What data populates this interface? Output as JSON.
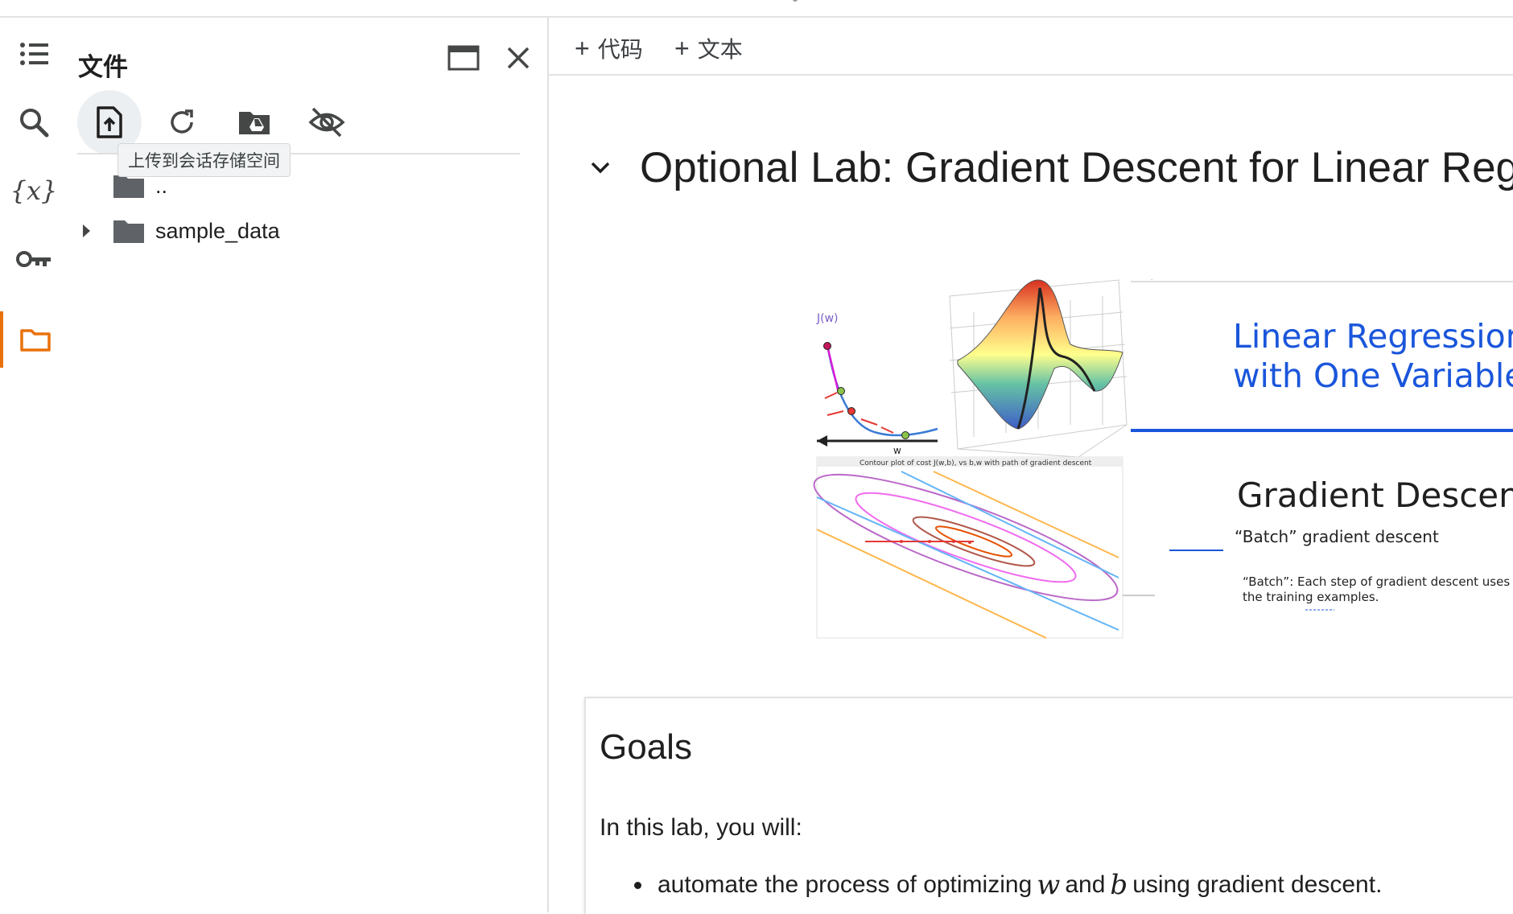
{
  "sidebar": {
    "panel_title": "文件",
    "rail_variables_label": "{x}",
    "upload_tooltip": "上传到会话存储空间",
    "tree": [
      {
        "label": ".."
      },
      {
        "label": "sample_data"
      }
    ]
  },
  "notebook": {
    "add_code_label": "代码",
    "add_text_label": "文本",
    "section_title": "Optional Lab: Gradient Descent for Linear Regre",
    "slide": {
      "contour_caption": "Contour plot of cost J(w,b), vs b,w with path of gradient descent",
      "axis_w_label": "w",
      "axis_j_label": "J(w)",
      "blue_line1": "Linear Regression",
      "blue_line2": "with One Variable",
      "gd_heading": "Gradient Descent",
      "batch_sub": "“Batch” gradient descent",
      "batch_desc_1": "“Batch”: Each step of gradient descent uses",
      "batch_desc_2": "the training examples."
    },
    "goals_heading": "Goals",
    "goals_intro": "In this lab, you will:",
    "bullet_pre": "automate the process of optimizing",
    "bullet_w": "w",
    "bullet_and": "and",
    "bullet_b": "b",
    "bullet_post": "using gradient descent."
  },
  "colors": {
    "accent_orange": "#e8710a",
    "slide_blue": "#1a56db",
    "icon_gray": "#444746"
  }
}
